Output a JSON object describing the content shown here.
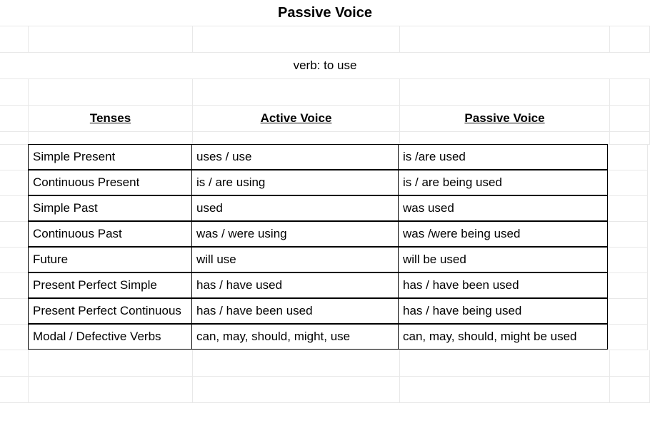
{
  "title": "Passive Voice",
  "subtitle": "verb: to use",
  "headers": {
    "tenses": "Tenses",
    "active": "Active Voice",
    "passive": "Passive Voice"
  },
  "rows": [
    {
      "tense": "Simple Present",
      "active": "uses / use",
      "passive": "is /are used"
    },
    {
      "tense": "Continuous Present",
      "active": "is / are using",
      "passive": "is / are being used"
    },
    {
      "tense": "Simple Past",
      "active": "used",
      "passive": "was used"
    },
    {
      "tense": "Continuous Past",
      "active": "was / were using",
      "passive": "was /were being used"
    },
    {
      "tense": "Future",
      "active": "will use",
      "passive": "will be used"
    },
    {
      "tense": "Present Perfect Simple",
      "active": "has / have used",
      "passive": "has / have been used"
    },
    {
      "tense": "Present Perfect Continuous",
      "active": "has / have been used",
      "passive": "has / have being used"
    },
    {
      "tense": "Modal / Defective Verbs",
      "active": "can, may, should, might, use",
      "passive": "can, may, should, might be used"
    }
  ]
}
